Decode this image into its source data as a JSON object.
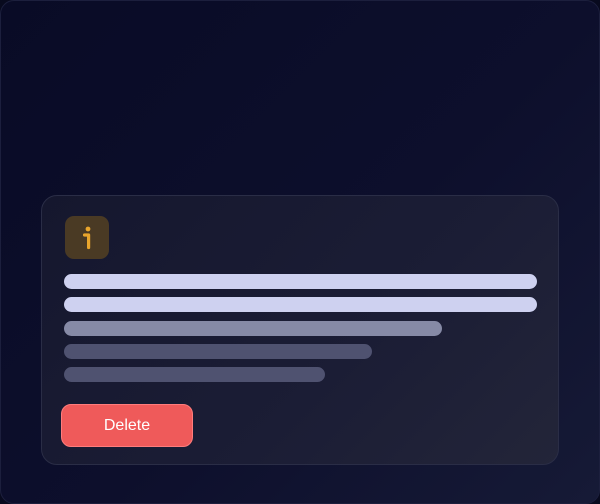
{
  "colors": {
    "background": "#080a1e",
    "card": "#1b1d35",
    "icon_bg": "#4a3a24",
    "icon_accent": "#e9a52c",
    "text_placeholder_primary": "#ced1f0",
    "text_placeholder_secondary": "#868aa6",
    "text_placeholder_muted": "#4f5270",
    "danger": "#ef5a5a"
  },
  "card": {
    "icon": "info-icon",
    "actions": {
      "delete_label": "Delete"
    }
  }
}
